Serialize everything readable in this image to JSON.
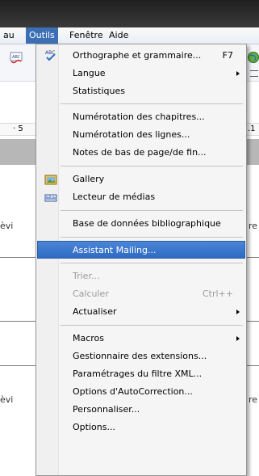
{
  "menubar": {
    "items": [
      {
        "label": "au",
        "active": false
      },
      {
        "label": "Outils",
        "active": true
      },
      {
        "label": "Fenêtre",
        "active": false
      },
      {
        "label": "Aide",
        "active": false
      }
    ]
  },
  "background": {
    "ruler_left": "· 5",
    "ruler_right": ".1 ·",
    "frag_left_1": "èvi",
    "frag_right_1": "re",
    "frag_left_2": "èvi",
    "frag_right_2": "re",
    "toolbar_left_icon": "spellcheck-abc-icon",
    "toolbar_right_icon": "globe-icon"
  },
  "menu": {
    "items": [
      {
        "label": "Orthographe et grammaire...",
        "shortcut": "F7",
        "icon": "spellcheck-icon"
      },
      {
        "label": "Langue",
        "submenu": true
      },
      {
        "label": "Statistiques"
      },
      {
        "label": "Numérotation des chapitres..."
      },
      {
        "label": "Numérotation des lignes..."
      },
      {
        "label": "Notes de bas de page/de fin..."
      },
      {
        "label": "Gallery",
        "icon": "gallery-icon"
      },
      {
        "label": "Lecteur de médias",
        "icon": "media-player-icon"
      },
      {
        "label": "Base de données bibliographique"
      },
      {
        "label": "Assistant Mailing...",
        "highlighted": true
      },
      {
        "label": "Trier...",
        "disabled": true
      },
      {
        "label": "Calculer",
        "shortcut": "Ctrl++",
        "disabled": true
      },
      {
        "label": "Actualiser",
        "submenu": true
      },
      {
        "label": "Macros",
        "submenu": true
      },
      {
        "label": "Gestionnaire des extensions..."
      },
      {
        "label": "Paramétrages du filtre XML..."
      },
      {
        "label": "Options d'AutoCorrection..."
      },
      {
        "label": "Personnaliser..."
      },
      {
        "label": "Options..."
      }
    ]
  },
  "colors": {
    "highlight": "#3d78cc",
    "menu_bg": "#f5f5f5",
    "titlebar": "#2a2a2a"
  }
}
